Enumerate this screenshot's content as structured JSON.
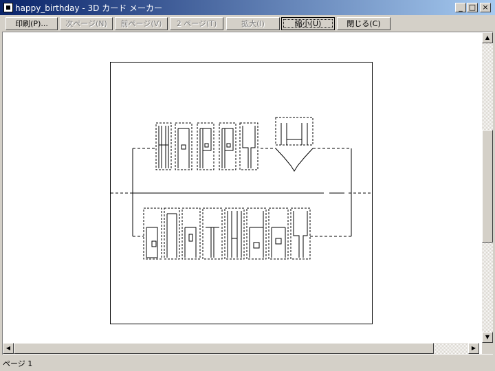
{
  "window": {
    "title": "happy_birthday - 3D カード メーカー",
    "controls": {
      "minimize": "_",
      "maximize": "□",
      "close": "×"
    }
  },
  "toolbar": {
    "buttons": [
      {
        "label": "印刷(P)...",
        "enabled": true
      },
      {
        "label": "次ページ(N)",
        "enabled": false
      },
      {
        "label": "前ページ(V)",
        "enabled": false
      },
      {
        "label": "2 ページ(T)",
        "enabled": false
      },
      {
        "label": "拡大(I)",
        "enabled": false
      },
      {
        "label": "縮小(U)",
        "enabled": true,
        "focused": true
      },
      {
        "label": "閉じる(C)",
        "enabled": true
      }
    ]
  },
  "card": {
    "top_text": "HAPPY",
    "bottom_text": "BIRTHDAY",
    "icon": "heart-icon"
  },
  "statusbar": {
    "page": "ページ 1"
  },
  "colors": {
    "titlebar_start": "#0a246a",
    "titlebar_end": "#a6caf0",
    "face": "#d4d0c8"
  }
}
